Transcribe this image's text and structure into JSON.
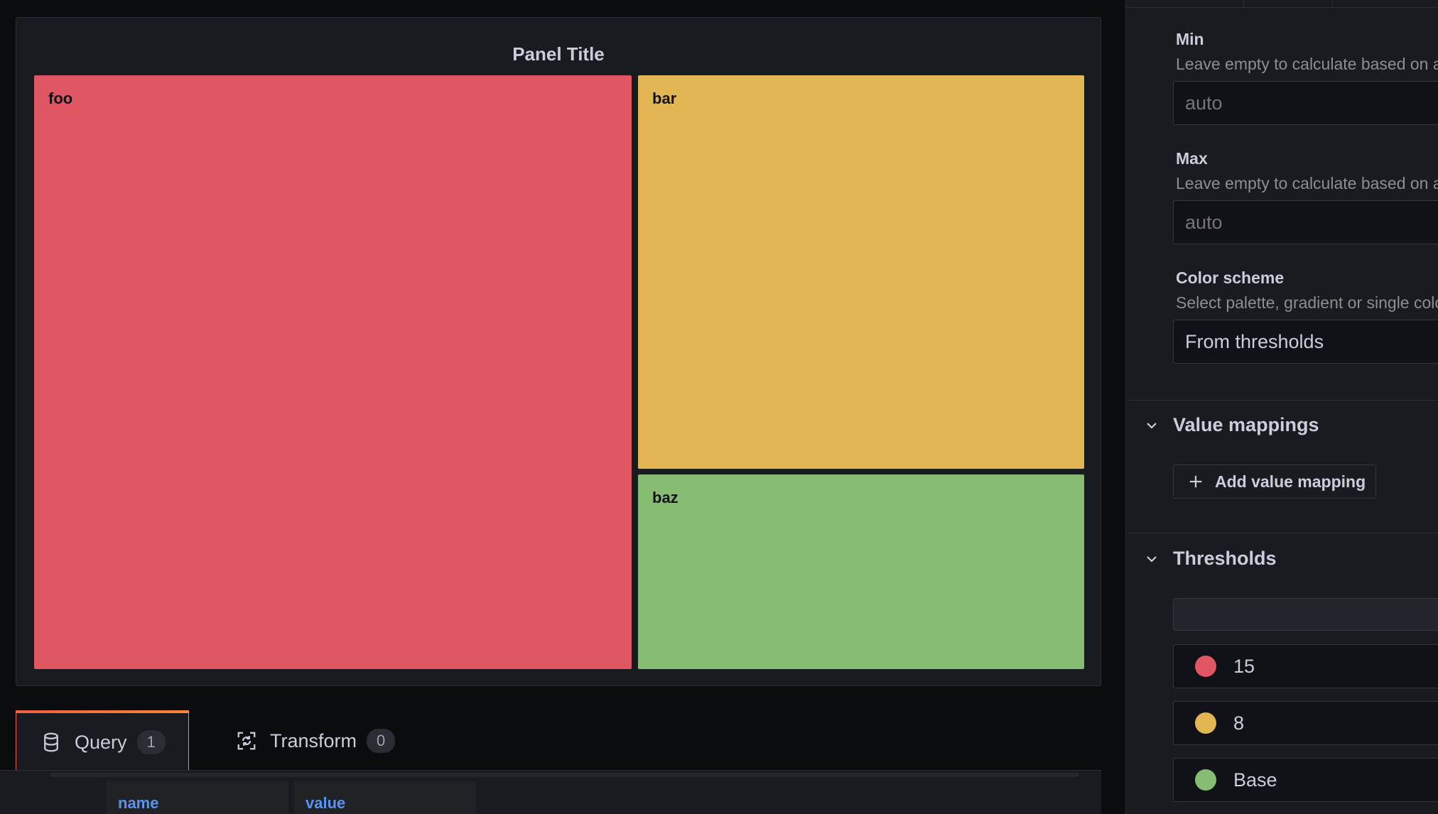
{
  "panel": {
    "title": "Panel Title",
    "treemap": [
      {
        "label": "foo",
        "color": "#e05763"
      },
      {
        "label": "bar",
        "color": "#e2b753"
      },
      {
        "label": "baz",
        "color": "#87bd72"
      }
    ]
  },
  "tabs": [
    {
      "label": "Query",
      "count": "1",
      "icon": "database-icon"
    },
    {
      "label": "Transform",
      "count": "0",
      "icon": "transform-icon"
    }
  ],
  "query_table": {
    "columns": [
      "name",
      "value"
    ]
  },
  "options": {
    "min": {
      "label": "Min",
      "description": "Leave empty to calculate based on all values",
      "placeholder": "auto"
    },
    "max": {
      "label": "Max",
      "description": "Leave empty to calculate based on all values",
      "placeholder": "auto"
    },
    "color_scheme": {
      "label": "Color scheme",
      "description": "Select palette, gradient or single color",
      "value": "From thresholds"
    },
    "value_mappings": {
      "title": "Value mappings",
      "add_label": "Add value mapping"
    },
    "thresholds": {
      "title": "Thresholds",
      "steps": [
        {
          "value": "15",
          "color": "#e05763"
        },
        {
          "value": "8",
          "color": "#e2b753"
        },
        {
          "value": "Base",
          "color": "#87bd72"
        }
      ]
    }
  }
}
